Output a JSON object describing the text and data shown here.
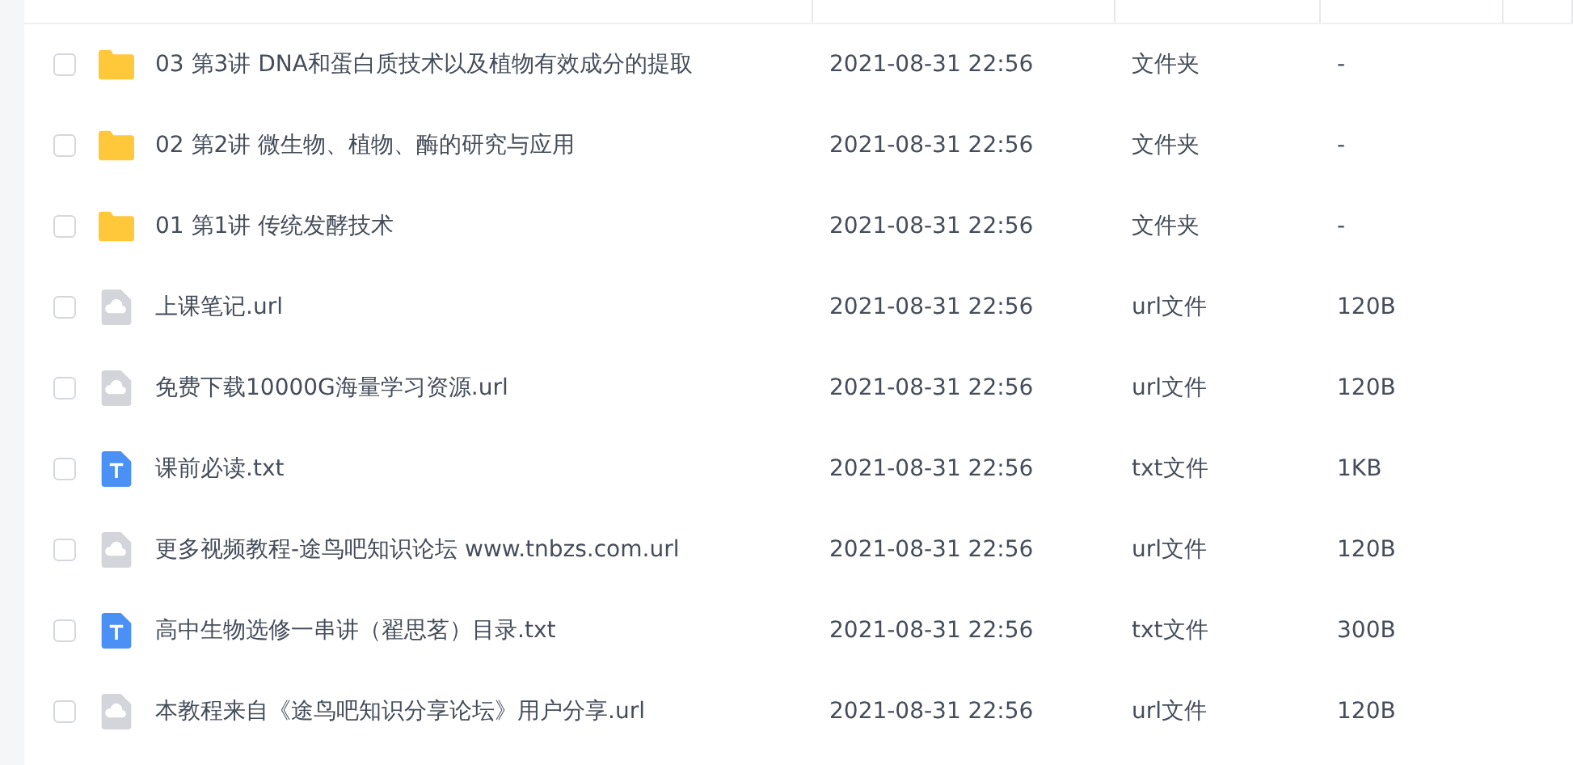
{
  "files": [
    {
      "kind": "folder",
      "name": "03 第3讲 DNA和蛋白质技术以及植物有效成分的提取",
      "modified": "2021-08-31 22:56",
      "type": "文件夹",
      "size": "-",
      "checked": false
    },
    {
      "kind": "folder",
      "name": "02 第2讲 微生物、植物、酶的研究与应用",
      "modified": "2021-08-31 22:56",
      "type": "文件夹",
      "size": "-",
      "checked": false
    },
    {
      "kind": "folder",
      "name": "01 第1讲 传统发酵技术",
      "modified": "2021-08-31 22:56",
      "type": "文件夹",
      "size": "-",
      "checked": false
    },
    {
      "kind": "url",
      "name": "上课笔记.url",
      "modified": "2021-08-31 22:56",
      "type": "url文件",
      "size": "120B",
      "checked": false
    },
    {
      "kind": "url",
      "name": "免费下载10000G海量学习资源.url",
      "modified": "2021-08-31 22:56",
      "type": "url文件",
      "size": "120B",
      "checked": false
    },
    {
      "kind": "txt",
      "name": "课前必读.txt",
      "modified": "2021-08-31 22:56",
      "type": "txt文件",
      "size": "1KB",
      "checked": false
    },
    {
      "kind": "url",
      "name": "更多视频教程-途鸟吧知识论坛 www.tnbzs.com.url",
      "modified": "2021-08-31 22:56",
      "type": "url文件",
      "size": "120B",
      "checked": false
    },
    {
      "kind": "txt",
      "name": "高中生物选修一串讲（翟思茗）目录.txt",
      "modified": "2021-08-31 22:56",
      "type": "txt文件",
      "size": "300B",
      "checked": false
    },
    {
      "kind": "url",
      "name": "本教程来自《途鸟吧知识分享论坛》用户分享.url",
      "modified": "2021-08-31 22:56",
      "type": "url文件",
      "size": "120B",
      "checked": false
    }
  ]
}
